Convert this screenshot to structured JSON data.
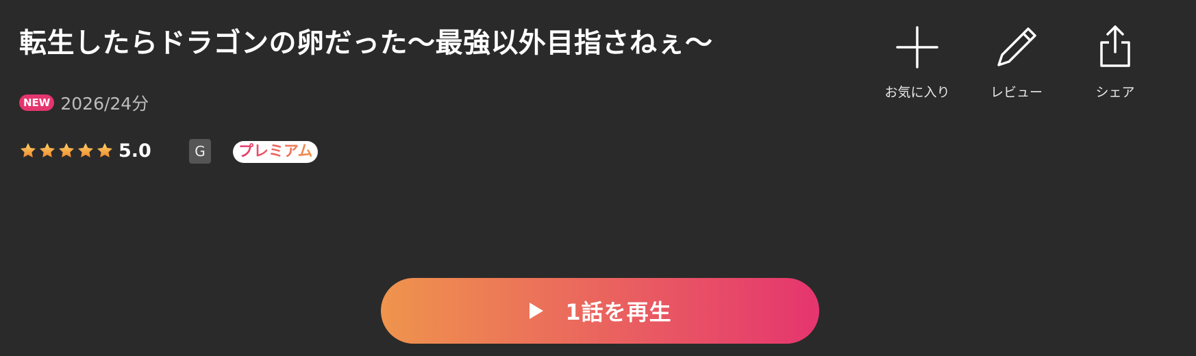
{
  "title": "転生したらドラゴンの卵だった〜最強以外目指さねぇ〜",
  "meta": {
    "new_badge": "NEW",
    "year_duration": "2026/24分"
  },
  "rating": {
    "stars": 5,
    "score": "5.0",
    "age_rating": "G",
    "premium_label": "プレミアム"
  },
  "actions": [
    {
      "label": "お気に入り",
      "icon": "plus-icon"
    },
    {
      "label": "レビュー",
      "icon": "pencil-icon"
    },
    {
      "label": "シェア",
      "icon": "share-icon"
    }
  ],
  "play_button": {
    "label": "1話を再生",
    "icon": "play-icon"
  },
  "colors": {
    "background": "#2a2a2a",
    "accent_pink": "#e5356f",
    "accent_orange": "#ef944d",
    "star": "#f5a623"
  }
}
